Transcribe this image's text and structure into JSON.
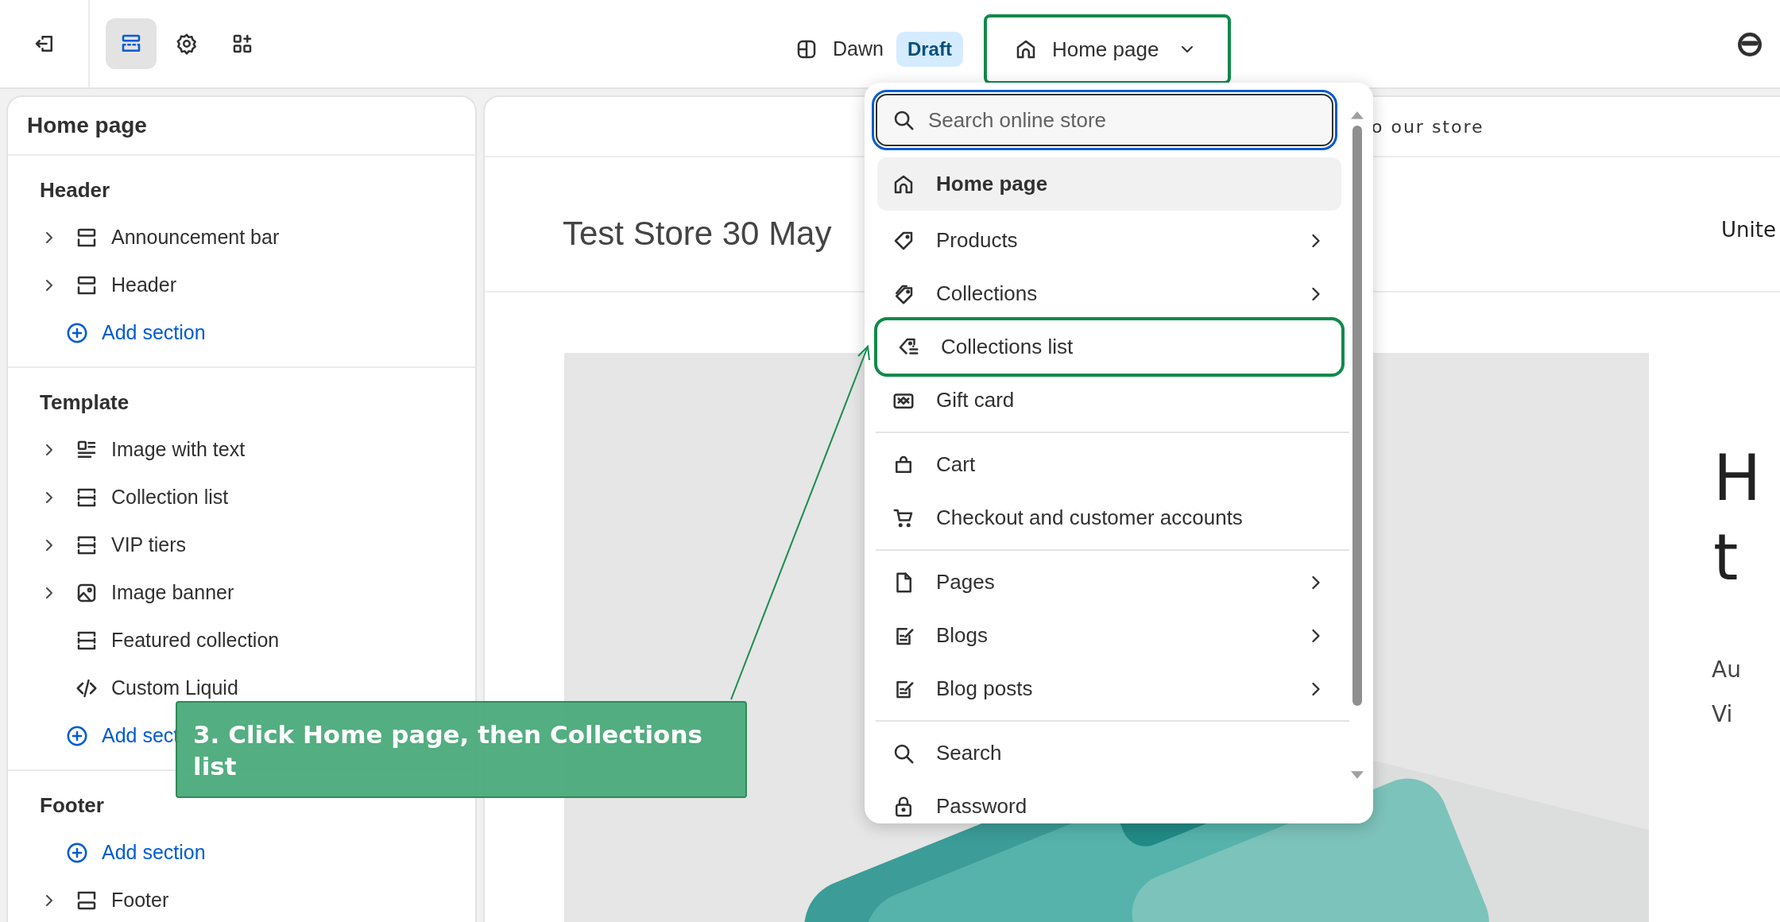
{
  "topbar": {
    "tools": [
      {
        "selected": false
      },
      {
        "selected": true
      },
      {
        "selected": false
      },
      {
        "selected": false
      }
    ],
    "theme": "Dawn",
    "badge": "Draft",
    "page_selector": {
      "label": "Home page",
      "highlighted": true
    }
  },
  "sidebar": {
    "title": "Home page",
    "groups": [
      {
        "title": "Header",
        "items": [
          {
            "kind": "header",
            "label": "Announcement bar",
            "expandable": true
          },
          {
            "kind": "header",
            "label": "Header",
            "expandable": true
          },
          {
            "kind": "add",
            "label": "Add section"
          }
        ]
      },
      {
        "title": "Template",
        "items": [
          {
            "kind": "mediatext",
            "label": "Image with text",
            "expandable": true
          },
          {
            "kind": "block",
            "label": "Collection list",
            "expandable": true
          },
          {
            "kind": "block",
            "label": "VIP tiers",
            "expandable": true
          },
          {
            "kind": "media",
            "label": "Image banner",
            "expandable": true
          },
          {
            "kind": "block",
            "label": "Featured collection",
            "expandable": false
          },
          {
            "kind": "code",
            "label": "Custom Liquid",
            "expandable": false
          },
          {
            "kind": "add",
            "label": "Add sect"
          }
        ]
      },
      {
        "title": "Footer",
        "items": [
          {
            "kind": "add",
            "label": "Add section"
          },
          {
            "kind": "footer",
            "label": "Footer",
            "expandable": true
          }
        ]
      }
    ]
  },
  "preview": {
    "announcement": "o our store",
    "store_name": "Test Store 30 May",
    "header_right": "Unite",
    "banner_text": [
      "H",
      "t",
      "Au",
      "Vi"
    ]
  },
  "dropdown": {
    "search": {
      "placeholder": "Search online store"
    },
    "groups": [
      [
        {
          "label": "Home page",
          "submenu": false,
          "selected": true,
          "highlighted": false
        },
        {
          "label": "Products",
          "submenu": true,
          "selected": false,
          "highlighted": false
        },
        {
          "label": "Collections",
          "submenu": true,
          "selected": false,
          "highlighted": false
        },
        {
          "label": "Collections list",
          "submenu": false,
          "selected": false,
          "highlighted": true
        },
        {
          "label": "Gift card",
          "submenu": false,
          "selected": false,
          "highlighted": false
        }
      ],
      [
        {
          "label": "Cart",
          "submenu": false,
          "selected": false,
          "highlighted": false
        },
        {
          "label": "Checkout and customer accounts",
          "submenu": false,
          "selected": false,
          "highlighted": false
        }
      ],
      [
        {
          "label": "Pages",
          "submenu": true,
          "selected": false,
          "highlighted": false
        },
        {
          "label": "Blogs",
          "submenu": true,
          "selected": false,
          "highlighted": false
        },
        {
          "label": "Blog posts",
          "submenu": true,
          "selected": false,
          "highlighted": false
        }
      ],
      [
        {
          "label": "Search",
          "submenu": false,
          "selected": false,
          "highlighted": false
        },
        {
          "label": "Password",
          "submenu": false,
          "selected": false,
          "highlighted": false
        }
      ]
    ]
  },
  "callout": {
    "text": "3. Click Home page, then Collections list"
  }
}
